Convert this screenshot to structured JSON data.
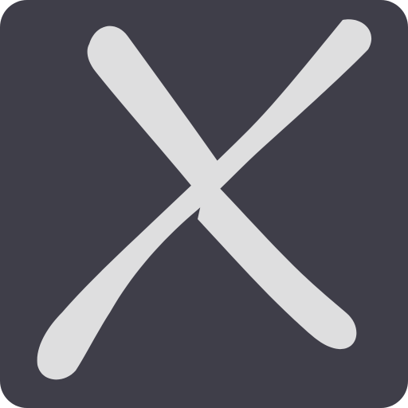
{
  "icon": {
    "name": "close-x-icon",
    "background_color": "#3f3e49",
    "glyph_color": "#dededf"
  }
}
